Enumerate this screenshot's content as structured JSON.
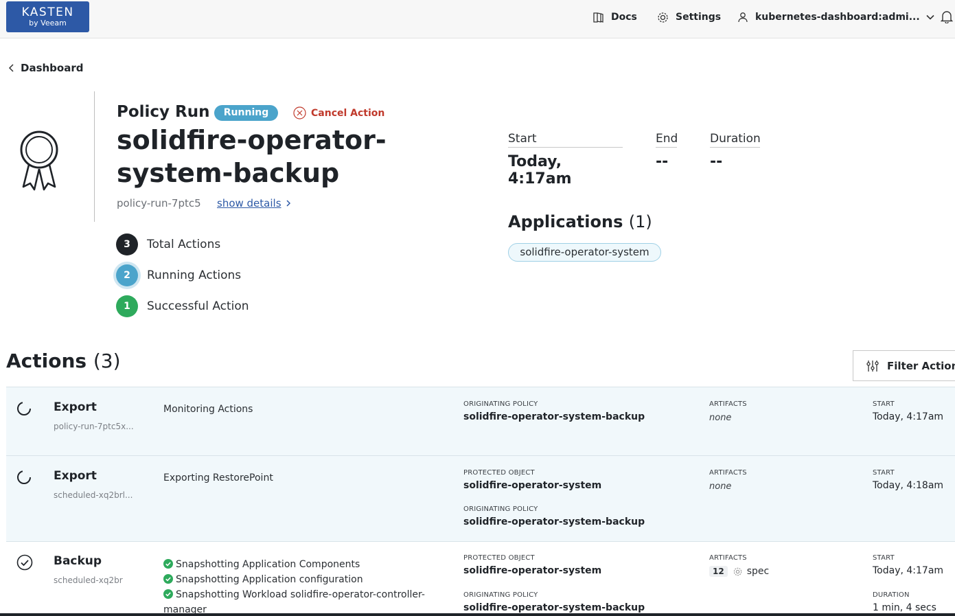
{
  "header": {
    "logo_line1": "KASTEN",
    "logo_line2": "by Veeam",
    "docs": "Docs",
    "settings": "Settings",
    "user": "kubernetes-dashboard:admi..."
  },
  "breadcrumb": {
    "back": "Dashboard"
  },
  "policy_run": {
    "label": "Policy Run",
    "status": "Running",
    "cancel": "Cancel Action",
    "title_line1": "solidfire-operator-",
    "title_line2": "system-backup",
    "run_id": "policy-run-7ptc5",
    "show_details": "show details"
  },
  "counts": [
    {
      "value": "3",
      "label": "Total Actions"
    },
    {
      "value": "2",
      "label": "Running Actions"
    },
    {
      "value": "1",
      "label": "Successful Action"
    }
  ],
  "times": {
    "start_label": "Start",
    "start_value": "Today, 4:17am",
    "end_label": "End",
    "end_value": "--",
    "duration_label": "Duration",
    "duration_value": "--"
  },
  "applications": {
    "heading": "Applications",
    "count": "(1)",
    "items": [
      "solidfire-operator-system"
    ]
  },
  "actions": {
    "heading": "Actions",
    "count": "(3)",
    "filter": "Filter Actions",
    "rows": [
      {
        "name": "Export",
        "sub": "policy-run-7ptc5x...",
        "desc": "Monitoring Actions",
        "originating_label": "ORIGINATING POLICY",
        "originating_value": "solidfire-operator-system-backup",
        "artifacts_label": "ARTIFACTS",
        "artifacts_value": "none",
        "start_label": "START",
        "start_value": "Today, 4:17am"
      },
      {
        "name": "Export",
        "sub": "scheduled-xq2brl...",
        "desc": "Exporting RestorePoint",
        "protected_label": "PROTECTED OBJECT",
        "protected_value": "solidfire-operator-system",
        "originating_label": "ORIGINATING POLICY",
        "originating_value": "solidfire-operator-system-backup",
        "artifacts_label": "ARTIFACTS",
        "artifacts_value": "none",
        "start_label": "START",
        "start_value": "Today, 4:18am"
      },
      {
        "name": "Backup",
        "sub": "scheduled-xq2br",
        "steps": [
          "Snapshotting Application Components",
          "Snapshotting Application configuration",
          "Snapshotting Workload solidfire-operator-controller-manager"
        ],
        "protected_label": "PROTECTED OBJECT",
        "protected_value": "solidfire-operator-system",
        "originating_label": "ORIGINATING POLICY",
        "originating_value": "solidfire-operator-system-backup",
        "artifacts_label": "ARTIFACTS",
        "artifacts_count": "12",
        "artifacts_kind": "spec",
        "start_label": "START",
        "start_value": "Today, 4:17am",
        "duration_label": "DURATION",
        "duration_value": "1 min, 4 secs"
      }
    ]
  },
  "colors": {
    "brand": "#2d59a6",
    "running": "#4ba4cb",
    "success": "#2eaa5c",
    "danger": "#c0392b",
    "row_bg": "#f1f8fb"
  },
  "icons": [
    "book-icon",
    "gear-icon",
    "user-icon",
    "chevron-down-icon",
    "bell-icon",
    "chevron-left-icon",
    "award-ribbon-icon",
    "cancel-x-icon",
    "chevron-right-icon",
    "sliders-icon",
    "spinner-icon",
    "check-circle-icon",
    "spec-gear-icon"
  ]
}
